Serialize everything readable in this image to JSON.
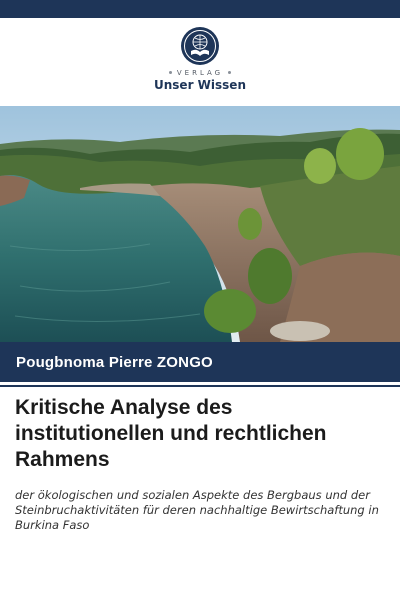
{
  "publisher": {
    "kicker": "VERLAG",
    "name": "Unser Wissen",
    "emblem": "book-globe-emblem-icon",
    "brand_color": "#1e3558"
  },
  "cover_image": {
    "description_icon": "landscape-lake-quarry-icon"
  },
  "author": "Pougbnoma Pierre ZONGO",
  "title": "Kritische Analyse des institutionellen und rechtlichen Rahmens",
  "subtitle": "der ökologischen und sozialen Aspekte des Bergbaus und der Steinbruchaktivitäten für deren nachhaltige Bewirtschaftung in Burkina Faso"
}
